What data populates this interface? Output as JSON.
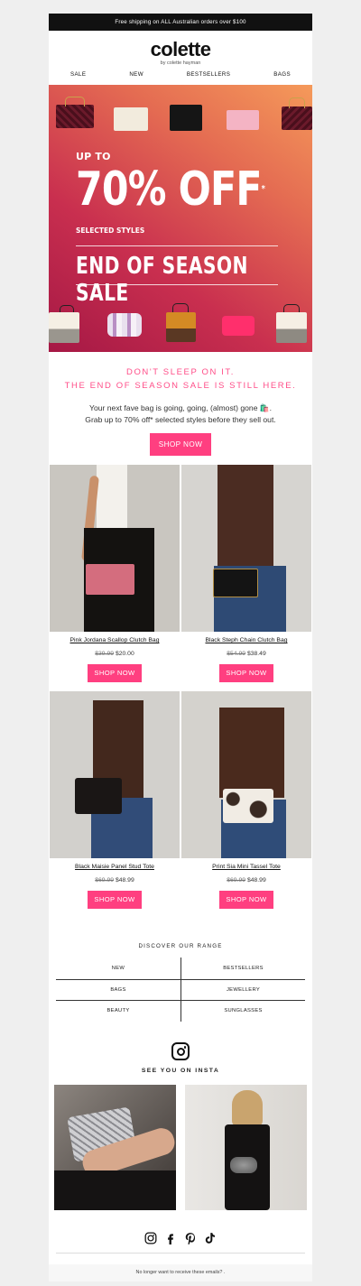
{
  "promo_bar": "Free shipping on ALL Australian orders over $100",
  "logo": {
    "name": "colette",
    "tagline": "by colette hayman"
  },
  "nav": [
    "SALE",
    "NEW",
    "BESTSELLERS",
    "BAGS"
  ],
  "hero": {
    "up_to": "UP TO",
    "percent": "70% OFF",
    "asterisk": "*",
    "selected": "SELECTED STYLES",
    "sale": "END OF SEASON SALE"
  },
  "intro": {
    "headline_1": "DON'T SLEEP ON IT.",
    "headline_2": "THE END OF SEASON SALE IS STILL HERE.",
    "body_1": "Your next fave bag is going, going, (almost) gone 🛍️.",
    "body_2": "Grab up to 70% off* selected styles before they sell out.",
    "cta": "SHOP NOW"
  },
  "products": [
    {
      "name": "Pink Jordana Scallop Clutch Bag",
      "was": "$39.99",
      "now": "$20.00",
      "cta": "SHOP NOW"
    },
    {
      "name": "Black Steph Chain Clutch Bag",
      "was": "$54.99",
      "now": "$38.49",
      "cta": "SHOP NOW"
    },
    {
      "name": "Black Maisie Panel Stud Tote",
      "was": "$69.99",
      "now": "$48.99",
      "cta": "SHOP NOW"
    },
    {
      "name": "Print Sia Mini Tassel Tote",
      "was": "$69.99",
      "now": "$48.99",
      "cta": "SHOP NOW"
    }
  ],
  "range": {
    "title": "DISCOVER OUR RANGE",
    "items": [
      "NEW",
      "BESTSELLERS",
      "BAGS",
      "JEWELLERY",
      "BEAUTY",
      "SUNGLASSES"
    ]
  },
  "insta": {
    "title": "SEE YOU ON INSTA"
  },
  "social_icons": [
    "instagram-icon",
    "facebook-icon",
    "pinterest-icon",
    "tiktok-icon"
  ],
  "footer": "No longer want to receive these emails? .",
  "colors": {
    "accent": "#ff3f80",
    "headline": "#ff4d88",
    "bar": "#111111"
  }
}
